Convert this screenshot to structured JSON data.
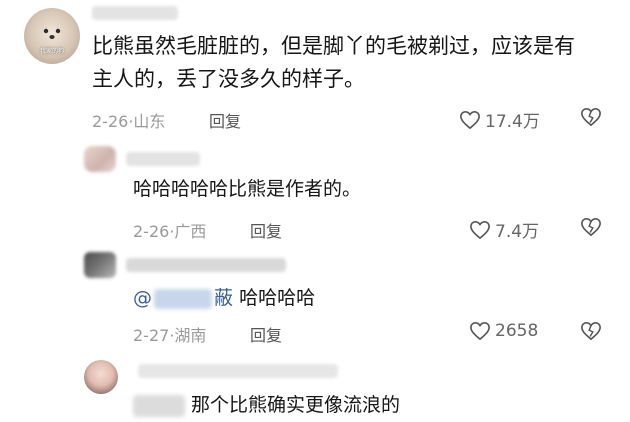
{
  "comments": [
    {
      "avatar_watermark": "我家的狗",
      "text_line1": "比熊虽然毛脏脏的，但是脚丫的毛被剃过，应该是有",
      "text_line2": "主人的，丢了没多久的样子。",
      "date": "2-26",
      "location": "山东",
      "reply_label": "回复",
      "likes": "17.4万"
    },
    {
      "text": "哈哈哈哈哈比熊是作者的。",
      "date": "2-26",
      "location": "广西",
      "reply_label": "回复",
      "likes": "7.4万"
    },
    {
      "mention_prefix": "@",
      "mention_suffix": "蔽",
      "text": "哈哈哈哈",
      "date": "2-27",
      "location": "湖南",
      "reply_label": "回复",
      "likes": "2658"
    },
    {
      "text": "那个比熊确实更像流浪的"
    }
  ],
  "separator": "·",
  "icons": {
    "like": "heart-outline-icon",
    "dislike": "broken-heart-icon"
  },
  "colors": {
    "mention": "#3a5f9e",
    "meta": "#9a9a9a"
  }
}
